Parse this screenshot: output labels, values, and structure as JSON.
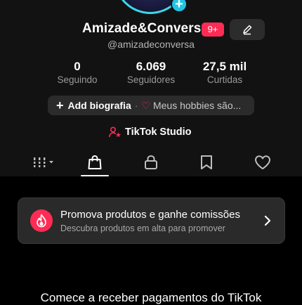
{
  "profile": {
    "display_name": "Amizade&Conversa",
    "notification_badge": "9+",
    "handle": "@amizadeconversa"
  },
  "stats": [
    {
      "value": "0",
      "label": "Seguindo"
    },
    {
      "value": "6.069",
      "label": "Seguidores"
    },
    {
      "value": "27,5 mil",
      "label": "Curtidas"
    }
  ],
  "bio": {
    "add_label": "Add biografia",
    "separator": "·",
    "hobbies_text": "Meus hobbies são..."
  },
  "studio": {
    "label": "TikTok Studio"
  },
  "tabs": [
    {
      "icon": "grid-icon",
      "active": false
    },
    {
      "icon": "shopping-bag-icon",
      "active": true
    },
    {
      "icon": "lock-icon",
      "active": false
    },
    {
      "icon": "bookmark-icon",
      "active": false
    },
    {
      "icon": "heart-icon",
      "active": false
    }
  ],
  "promo": {
    "title": "Promova produtos e ganhe comissões",
    "subtitle": "Descubra produtos em alta para promover",
    "icon": "flame-icon"
  },
  "payments_heading": "Comece a receber pagamentos do TikTok",
  "colors": {
    "accent": "#fe2c55",
    "avatar_ring": "#3fd6e8",
    "background": "#121212",
    "card": "#2a2a2a"
  }
}
